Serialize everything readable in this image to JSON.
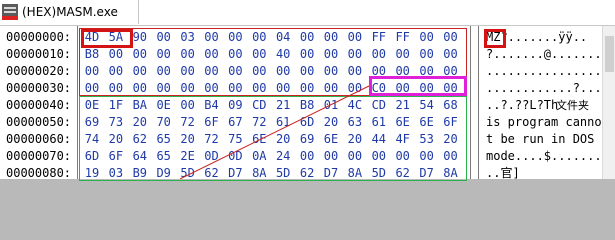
{
  "tab": {
    "title": "(HEX)MASM.exe",
    "icon": "exe-file-icon"
  },
  "rows": [
    {
      "addr": "00000000:",
      "hex": [
        "4D",
        "5A",
        "90",
        "00",
        "03",
        "00",
        "00",
        "00",
        "04",
        "00",
        "00",
        "00",
        "FF",
        "FF",
        "00",
        "00"
      ],
      "ascii": "MZ?.......ÿÿ.."
    },
    {
      "addr": "00000010:",
      "hex": [
        "B8",
        "00",
        "00",
        "00",
        "00",
        "00",
        "00",
        "00",
        "40",
        "00",
        "00",
        "00",
        "00",
        "00",
        "00",
        "00"
      ],
      "ascii": "?.......@......."
    },
    {
      "addr": "00000020:",
      "hex": [
        "00",
        "00",
        "00",
        "00",
        "00",
        "00",
        "00",
        "00",
        "00",
        "00",
        "00",
        "00",
        "00",
        "00",
        "00",
        "00"
      ],
      "ascii": "................"
    },
    {
      "addr": "00000030:",
      "hex": [
        "00",
        "00",
        "00",
        "00",
        "00",
        "00",
        "00",
        "00",
        "00",
        "00",
        "00",
        "00",
        "C0",
        "00",
        "00",
        "00"
      ],
      "ascii": "............?..."
    },
    {
      "addr": "00000040:",
      "hex": [
        "0E",
        "1F",
        "BA",
        "0E",
        "00",
        "B4",
        "09",
        "CD",
        "21",
        "B8",
        "01",
        "4C",
        "CD",
        "21",
        "54",
        "68"
      ],
      "ascii": "..?.??L?Th"
    },
    {
      "addr": "00000050:",
      "hex": [
        "69",
        "73",
        "20",
        "70",
        "72",
        "6F",
        "67",
        "72",
        "61",
        "6D",
        "20",
        "63",
        "61",
        "6E",
        "6E",
        "6F"
      ],
      "ascii": "is program canno"
    },
    {
      "addr": "00000060:",
      "hex": [
        "74",
        "20",
        "62",
        "65",
        "20",
        "72",
        "75",
        "6E",
        "20",
        "69",
        "6E",
        "20",
        "44",
        "4F",
        "53",
        "20"
      ],
      "ascii": "t be run in DOS "
    },
    {
      "addr": "00000070:",
      "hex": [
        "6D",
        "6F",
        "64",
        "65",
        "2E",
        "0D",
        "0D",
        "0A",
        "24",
        "00",
        "00",
        "00",
        "00",
        "00",
        "00",
        "00"
      ],
      "ascii": "mode....$......."
    },
    {
      "addr": "00000080:",
      "hex": [
        "19",
        "03",
        "B9",
        "D9",
        "5D",
        "62",
        "D7",
        "8A",
        "5D",
        "62",
        "D7",
        "8A",
        "5D",
        "62",
        "D7",
        "8A"
      ],
      "ascii": "..官]"
    }
  ],
  "tooltip": "文件夹",
  "colors": {
    "hex": "#1f3aa6",
    "highlight_red": "#d41414",
    "highlight_magenta": "#e020d8",
    "highlight_green": "#2bb24c"
  }
}
